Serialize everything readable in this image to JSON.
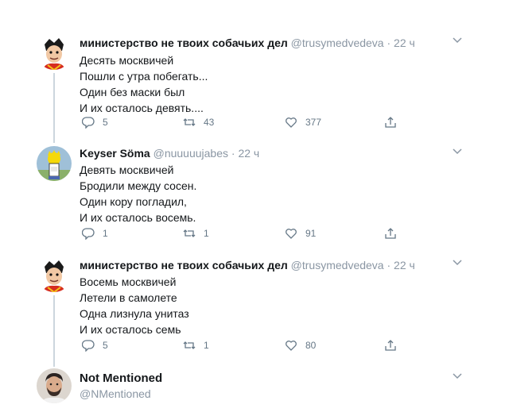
{
  "tweets": [
    {
      "name": "министерство не твоих собачьих дел",
      "handle": "@trusymedvedeva",
      "separator": "·",
      "time": "22 ч",
      "lines": [
        "Десять москвичей",
        "Пошли с утра побегать...",
        "Один без маски был",
        "И их осталось девять...."
      ],
      "replies": "5",
      "retweets": "43",
      "likes": "377"
    },
    {
      "name": "Keyser Söma",
      "handle": "@nuuuuujabes",
      "separator": "·",
      "time": "22 ч",
      "lines": [
        "Девять москвичей",
        "Бродили между сосен.",
        "Один кору погладил,",
        "И их осталось восемь."
      ],
      "replies": "1",
      "retweets": "1",
      "likes": "91"
    },
    {
      "name": "министерство не твоих собачьих дел",
      "handle": "@trusymedvedeva",
      "separator": "·",
      "time": "22 ч",
      "lines": [
        "Восемь москвичей",
        "Летели в самолете",
        "Одна лизнула унитаз",
        "И их осталось семь"
      ],
      "replies": "5",
      "retweets": "1",
      "likes": "80"
    }
  ],
  "profile": {
    "name": "Not Mentioned",
    "handle": "@NMentioned"
  },
  "colors": {
    "text": "#14171a",
    "muted": "#8a96a3",
    "icon": "#657786",
    "thread_line": "#ccd6dd"
  },
  "icons": {
    "reply": "reply-icon",
    "retweet": "retweet-icon",
    "like": "like-icon",
    "share": "share-icon",
    "menu": "chevron-down-icon"
  }
}
